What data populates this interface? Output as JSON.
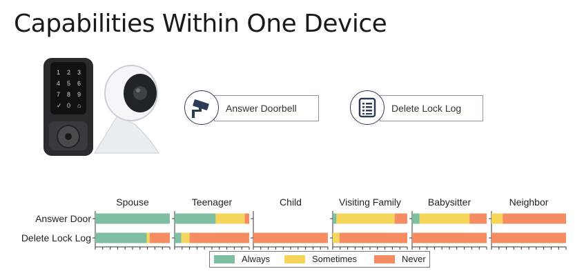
{
  "slide": {
    "title": "Capabilities Within One Device"
  },
  "capabilities": [
    {
      "label": "Answer Doorbell",
      "icon": "security-camera-icon"
    },
    {
      "label": "Delete Lock Log",
      "icon": "log-list-icon"
    }
  ],
  "colors": {
    "always": "#7dbfa0",
    "sometimes": "#f6d55c",
    "never": "#f68c61",
    "accent": "#2d3a56"
  },
  "chart_data": {
    "type": "bar",
    "orientation": "horizontal-stacked",
    "panels": [
      "Spouse",
      "Teenager",
      "Child",
      "Visiting Family",
      "Babysitter",
      "Neighbor"
    ],
    "rows": [
      "Answer Door",
      "Delete Lock Log"
    ],
    "legend": [
      "Always",
      "Sometimes",
      "Never"
    ],
    "legend_placement": "bottom",
    "xlim": [
      0,
      1
    ],
    "series": [
      {
        "name": "Always",
        "values": [
          [
            1.0,
            0.69
          ],
          [
            0.55,
            0.09
          ],
          [
            0.0,
            0.0
          ],
          [
            0.05,
            0.0
          ],
          [
            0.1,
            0.0
          ],
          [
            0.0,
            0.0
          ]
        ]
      },
      {
        "name": "Sometimes",
        "values": [
          [
            0.0,
            0.04
          ],
          [
            0.39,
            0.11
          ],
          [
            0.0,
            0.0
          ],
          [
            0.78,
            0.09
          ],
          [
            0.67,
            0.0
          ],
          [
            0.15,
            0.0
          ]
        ]
      },
      {
        "name": "Never",
        "values": [
          [
            0.0,
            0.27
          ],
          [
            0.06,
            0.8
          ],
          [
            0.0,
            1.0
          ],
          [
            0.17,
            0.91
          ],
          [
            0.23,
            1.0
          ],
          [
            0.85,
            1.0
          ]
        ]
      }
    ]
  }
}
